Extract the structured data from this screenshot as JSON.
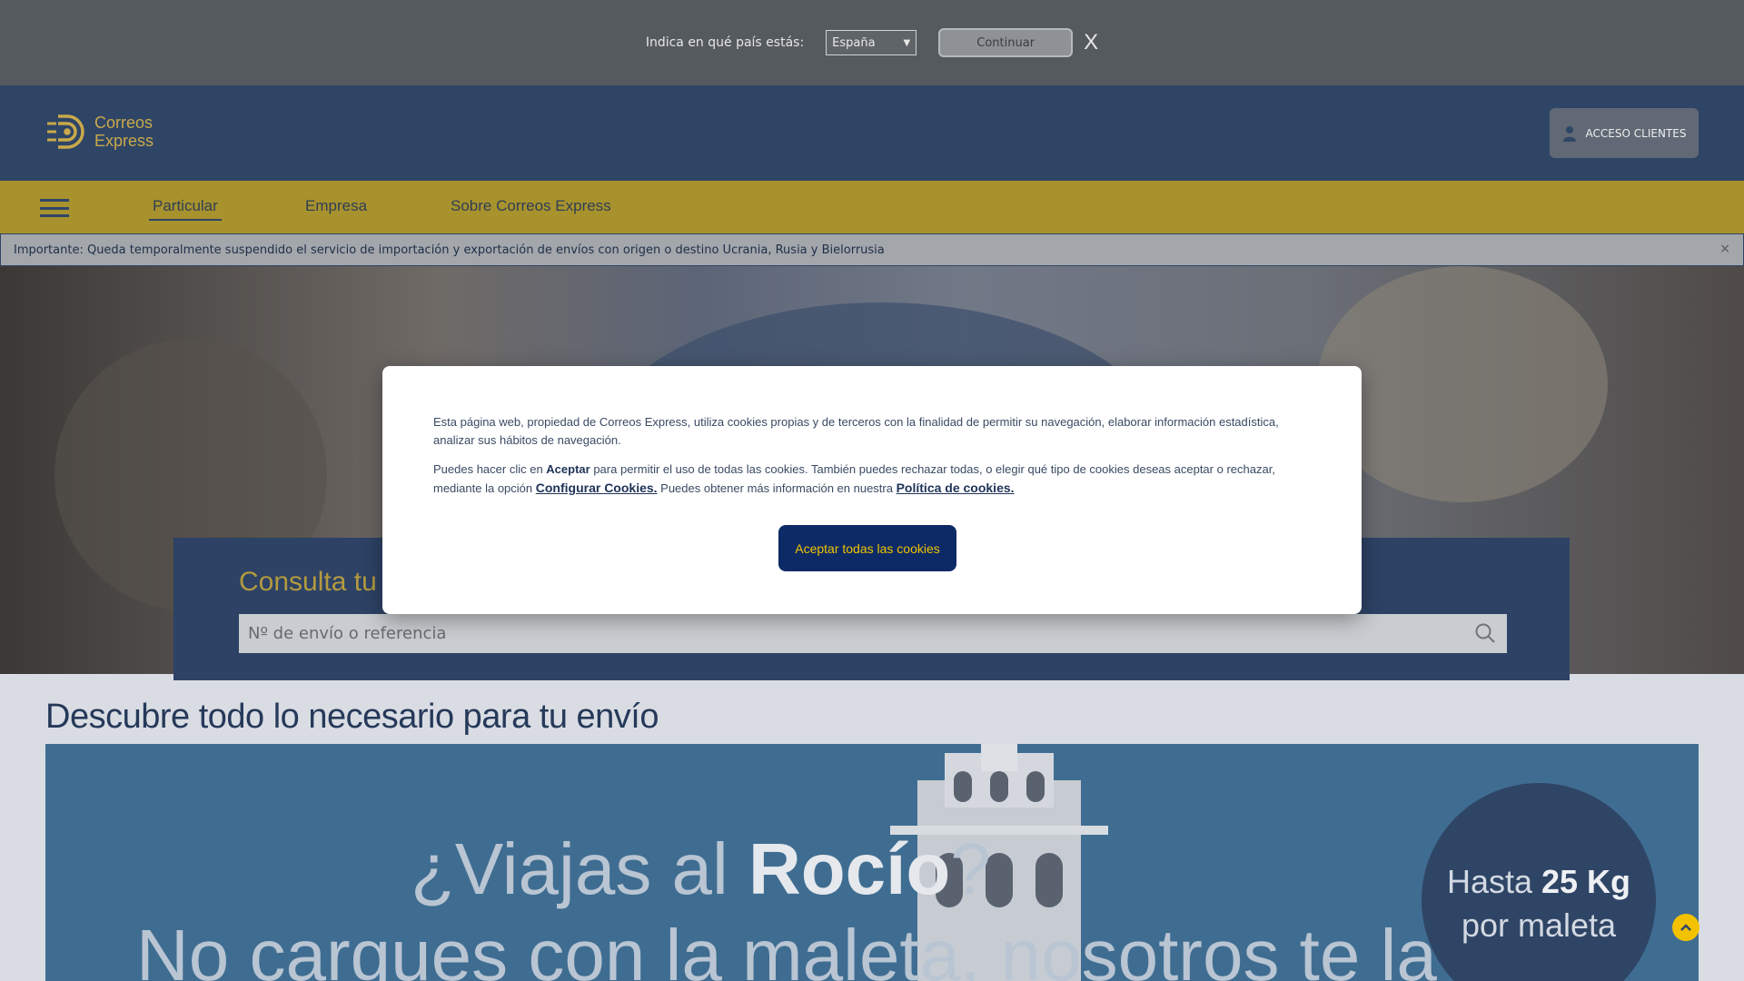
{
  "country_bar": {
    "label": "Indica en qué país estás:",
    "selected_country": "España",
    "continue_label": "Continuar",
    "close_label": "X"
  },
  "header": {
    "logo_line1": "Correos",
    "logo_line2": "Express",
    "access_label": "ACCESO CLIENTES"
  },
  "nav": {
    "items": [
      {
        "label": "Particular"
      },
      {
        "label": "Empresa"
      },
      {
        "label": "Sobre Correos Express"
      }
    ]
  },
  "alert": {
    "text": "Importante: Queda temporalmente suspendido el servicio de importación y exportación de envíos con origen o destino Ucrania, Rusia y Bielorrusia",
    "close_label": "×"
  },
  "tracking": {
    "title": "Consulta tu",
    "placeholder": "Nº de envío o referencia"
  },
  "section": {
    "title": "Descubre todo lo necesario para tu envío"
  },
  "promo": {
    "line1_prefix": "¿Viajas al ",
    "line1_bold": "Rocío",
    "line1_suffix": "?",
    "line2": "No cargues con la maleta, nosotros te la",
    "badge_prefix": "Hasta ",
    "badge_bold": "25 Kg",
    "badge_line2": "por maleta"
  },
  "cookie": {
    "p1": "Esta página web, propiedad de Correos Express, utiliza cookies propias y de terceros con la finalidad de permitir su navegación, elaborar información estadística, analizar sus hábitos de navegación.",
    "p2_a": "Puedes hacer clic en ",
    "p2_accept": "Aceptar",
    "p2_b": " para permitir el uso de todas las cookies. También puedes rechazar todas, o elegir qué tipo de cookies deseas aceptar o rechazar, mediante la opción ",
    "p2_config": "Configurar Cookies.",
    "p2_c": " Puedes obtener más información en nuestra ",
    "p2_policy": "Política de cookies.",
    "accept_button": "Aceptar todas las cookies"
  },
  "colors": {
    "brand_blue": "#2f4566",
    "brand_gold": "#a8922d",
    "accept_bg": "#0d2a66",
    "accept_text": "#f0c400"
  }
}
